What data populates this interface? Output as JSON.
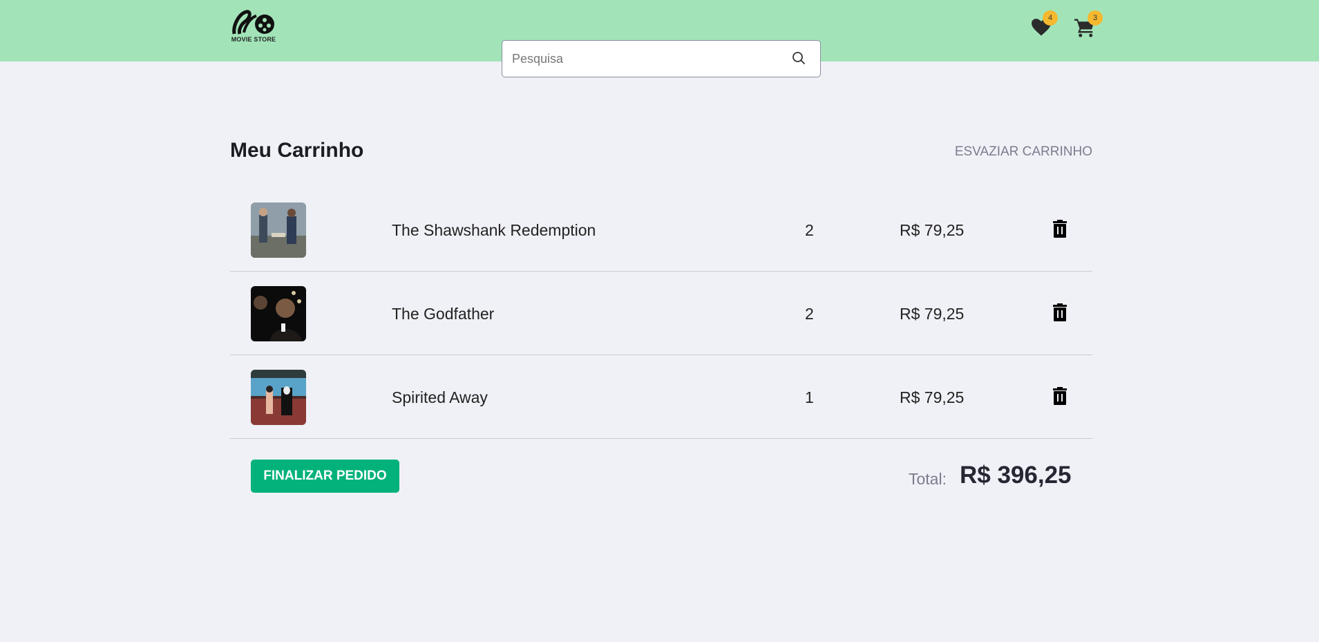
{
  "brand": {
    "logo_text": "MOVIE STORE"
  },
  "search": {
    "placeholder": "Pesquisa",
    "value": ""
  },
  "header": {
    "favorites_count": "4",
    "cart_count": "3",
    "background": "#a2e4b8"
  },
  "cart": {
    "title": "Meu Carrinho",
    "empty_label": "ESVAZIAR CARRINHO",
    "items": [
      {
        "name": "The Shawshank Redemption",
        "quantity": "2",
        "price": "R$ 79,25"
      },
      {
        "name": "The Godfather",
        "quantity": "2",
        "price": "R$ 79,25"
      },
      {
        "name": "Spirited Away",
        "quantity": "1",
        "price": "R$ 79,25"
      }
    ],
    "checkout_label": "FINALIZAR PEDIDO",
    "total_label": "Total:",
    "total_value": "R$ 396,25"
  },
  "colors": {
    "accent": "#03b27a",
    "badge": "#f5b82e",
    "page_bg": "#f0f1f6"
  },
  "icons": [
    "film-reel-logo-icon",
    "search-icon",
    "heart-icon",
    "cart-icon",
    "trash-icon"
  ]
}
